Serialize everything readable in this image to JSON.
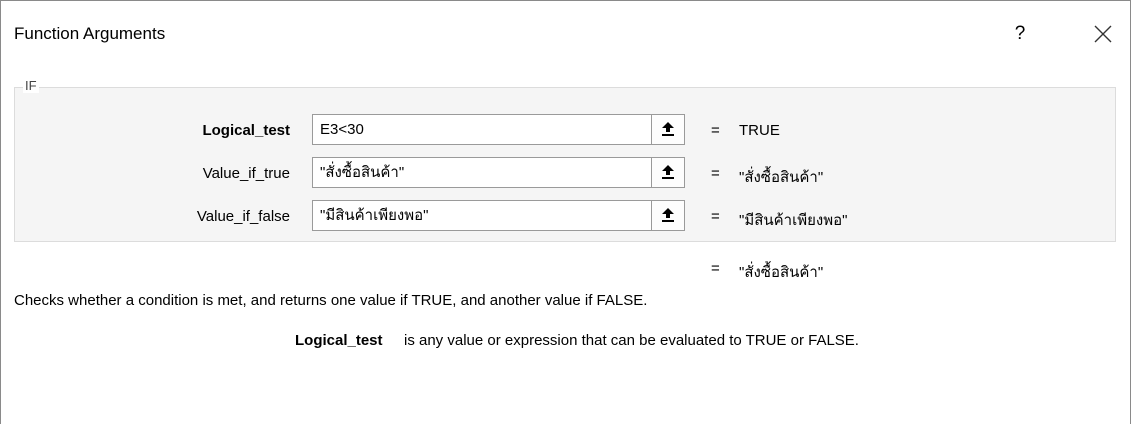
{
  "window": {
    "title": "Function Arguments",
    "help_label": "?"
  },
  "function": {
    "name": "IF",
    "arguments": [
      {
        "label": "Logical_test",
        "bold": true,
        "value": "E3<30",
        "result": "TRUE"
      },
      {
        "label": "Value_if_true",
        "bold": false,
        "value": "\"สั่งซื้อสินค้า\"",
        "result": "\"สั่งซื้อสินค้า\""
      },
      {
        "label": "Value_if_false",
        "bold": false,
        "value": "\"มีสินค้าเพียงพอ\"",
        "result": "\"มีสินค้าเพียงพอ\""
      }
    ],
    "equals": "=",
    "formula_result": "\"สั่งซื้อสินค้า\"",
    "description": "Checks whether a condition is met, and returns one value if TRUE, and another value if FALSE.",
    "argument_help": {
      "name": "Logical_test",
      "text": "is any value or expression that can be evaluated to TRUE or FALSE."
    }
  },
  "icons": {
    "close": "close-icon",
    "collapse": "collapse-dialog-icon"
  }
}
